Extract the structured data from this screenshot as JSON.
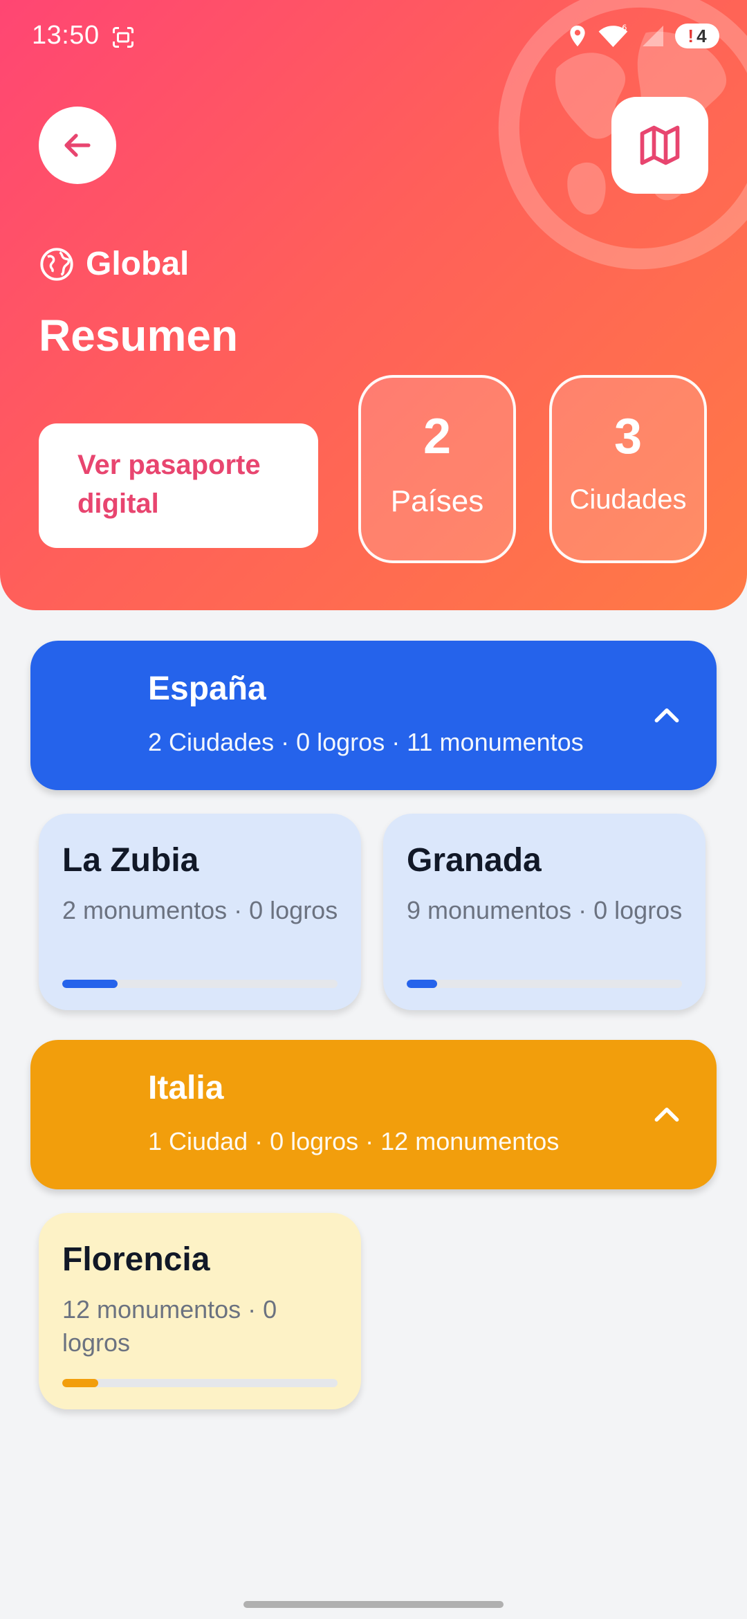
{
  "status_bar": {
    "time": "13:50",
    "battery_level": "4",
    "icons": [
      "screenshot-icon",
      "location-icon",
      "wifi-icon",
      "signal-icon",
      "battery-alert-icon"
    ]
  },
  "header": {
    "scope_icon": "globe-icon",
    "scope_label": "Global",
    "title": "Resumen",
    "passport_button_label": "Ver pasaporte digital",
    "stats": [
      {
        "value": "2",
        "label": "Países"
      },
      {
        "value": "3",
        "label": "Ciudades"
      }
    ],
    "colors": {
      "gradient_start": "#ff4673",
      "gradient_end": "#ff7a45",
      "accent": "#e8456f"
    }
  },
  "countries": [
    {
      "name": "España",
      "subtitle": "2 Ciudades · 0 logros · 11 monumentos",
      "color": "#2563eb",
      "expanded": true,
      "cities": [
        {
          "name": "La Zubia",
          "meta": "2 monumentos · 0 logros",
          "progress": 0.2,
          "bg": "#dbe7fb",
          "bar": "#2563eb"
        },
        {
          "name": "Granada",
          "meta": "9 monumentos · 0 logros",
          "progress": 0.11,
          "bg": "#dbe7fb",
          "bar": "#2563eb"
        }
      ]
    },
    {
      "name": "Italia",
      "subtitle": "1 Ciudad · 0 logros · 12 monumentos",
      "color": "#f29e0c",
      "expanded": true,
      "cities": [
        {
          "name": "Florencia",
          "meta": "12 monumentos · 0 logros",
          "progress": 0.13,
          "bg": "#fdf2c6",
          "bar": "#f29e0c"
        }
      ]
    }
  ]
}
